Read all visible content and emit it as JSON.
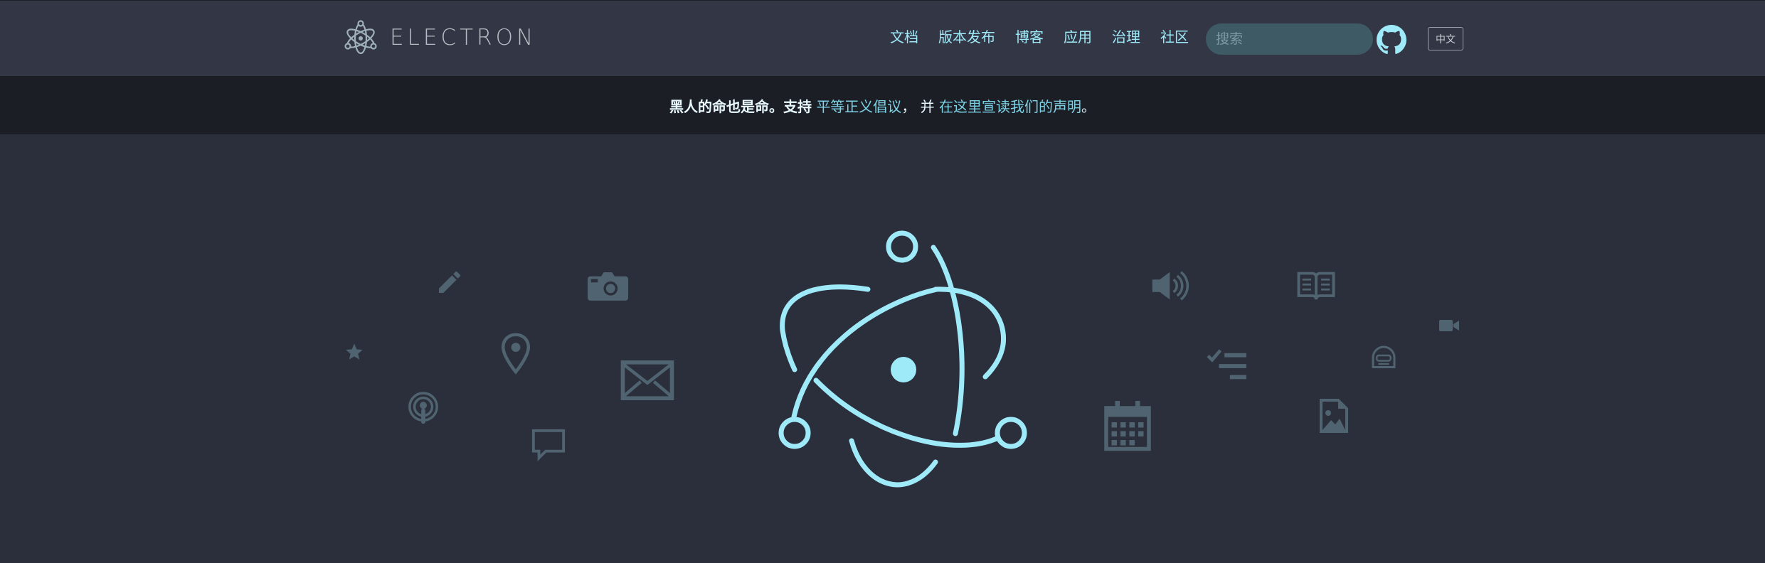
{
  "header": {
    "logo_text": "ELECTRON",
    "nav": [
      {
        "label": "文档"
      },
      {
        "label": "版本发布"
      },
      {
        "label": "博客"
      },
      {
        "label": "应用"
      },
      {
        "label": "治理"
      },
      {
        "label": "社区"
      }
    ],
    "search_placeholder": "搜索",
    "language_button": "中文"
  },
  "banner": {
    "statement": "黑人的命也是命。",
    "support": "支持",
    "link1": "平等正义倡议",
    "comma": "，",
    "and": "并",
    "link2": "在这里宣读我们的声明",
    "period": "。"
  },
  "colors": {
    "accent": "#9feaf9",
    "header_bg": "#323645",
    "banner_bg": "#1c1e26",
    "hero_bg": "#2b2f3b",
    "icon_gray": "#4f6470"
  },
  "hero_icons": [
    "star-icon",
    "pencil-icon",
    "location-pin-icon",
    "podcast-icon",
    "camera-icon",
    "envelope-icon",
    "chat-bubble-icon",
    "speaker-icon",
    "book-icon",
    "video-camera-icon",
    "checklist-icon",
    "robot-icon",
    "calendar-icon",
    "image-file-icon"
  ]
}
